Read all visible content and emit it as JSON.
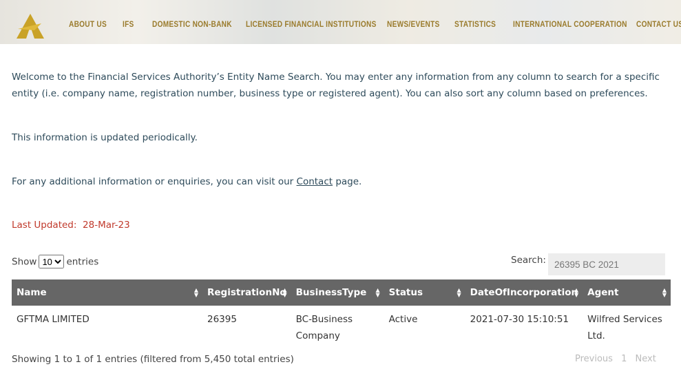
{
  "nav": {
    "items": [
      "ABOUT US",
      "IFS",
      "DOMESTIC NON-BANK",
      "LICENSED FINANCIAL INSTITUTIONS",
      "NEWS/EVENTS",
      "STATISTICS",
      "INTERNATIONAL COOPERATION",
      "CONTACT US"
    ]
  },
  "intro": {
    "welcome": "Welcome to the Financial Services Authority’s Entity Name Search. You may enter any information from any column to search for a specific entity (i.e. company name, registration number, business type or registered agent). You can also sort any column based on preferences.",
    "updated_note": "This information is updated periodically.",
    "contact_pre": "For any additional information or enquiries, you can visit our ",
    "contact_link": "Contact",
    "contact_post": " page.",
    "last_updated_label": "Last Updated:",
    "last_updated_value": "28-Mar-23"
  },
  "controls": {
    "show_label": "Show",
    "entries_value": "10",
    "entries_label": "entries",
    "search_label": "Search:",
    "search_value": "26395 BC 2021"
  },
  "table": {
    "headers": [
      "Name",
      "RegistrationNo",
      "BusinessType",
      "Status",
      "DateOfIncorporation",
      "Agent"
    ],
    "rows": [
      [
        "GFTMA LIMITED",
        "26395",
        "BC-Business Company",
        "Active",
        "2021-07-30 15:10:51",
        "Wilfred Services Ltd."
      ]
    ]
  },
  "footer": {
    "info": "Showing 1 to 1 of 1 entries (filtered from 5,450 total entries)",
    "prev": "Previous",
    "page": "1",
    "next": "Next"
  },
  "colors": {
    "nav": "#9a7b2c",
    "header_bg": "#666666",
    "last_updated": "#c0392b",
    "text": "#2d4a5a"
  }
}
